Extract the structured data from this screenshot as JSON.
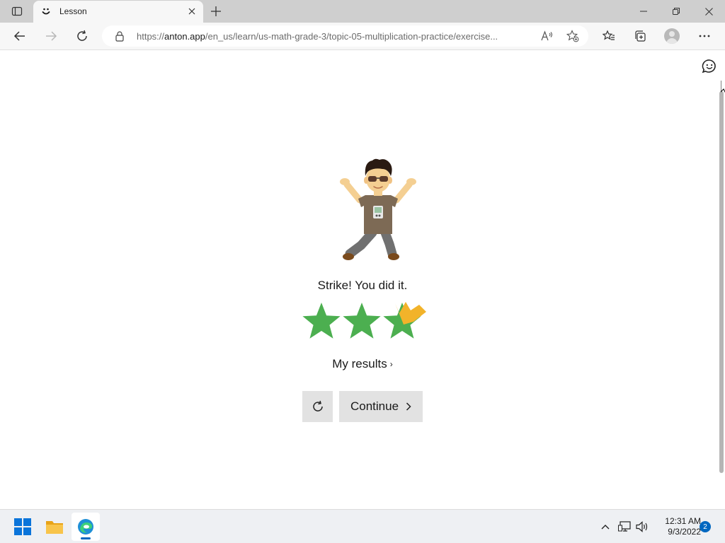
{
  "browser": {
    "tab": {
      "title": "Lesson"
    },
    "address": {
      "url_scheme": "https://",
      "url_host": "anton.app",
      "url_path": "/en_us/learn/us-math-grade-3/topic-05-multiplication-practice/exercise..."
    }
  },
  "lesson": {
    "message": "Strike! You did it.",
    "stars_earned": 3,
    "stars_total": 3,
    "star_color": "#4caf50",
    "crown_color": "#f2b32a",
    "results_link": "My results",
    "continue_label": "Continue"
  },
  "taskbar": {
    "apps": [
      "windows-start",
      "file-explorer",
      "microsoft-edge"
    ],
    "clock": {
      "time": "12:31 AM",
      "date": "9/3/2022"
    },
    "notification_count": "2"
  }
}
